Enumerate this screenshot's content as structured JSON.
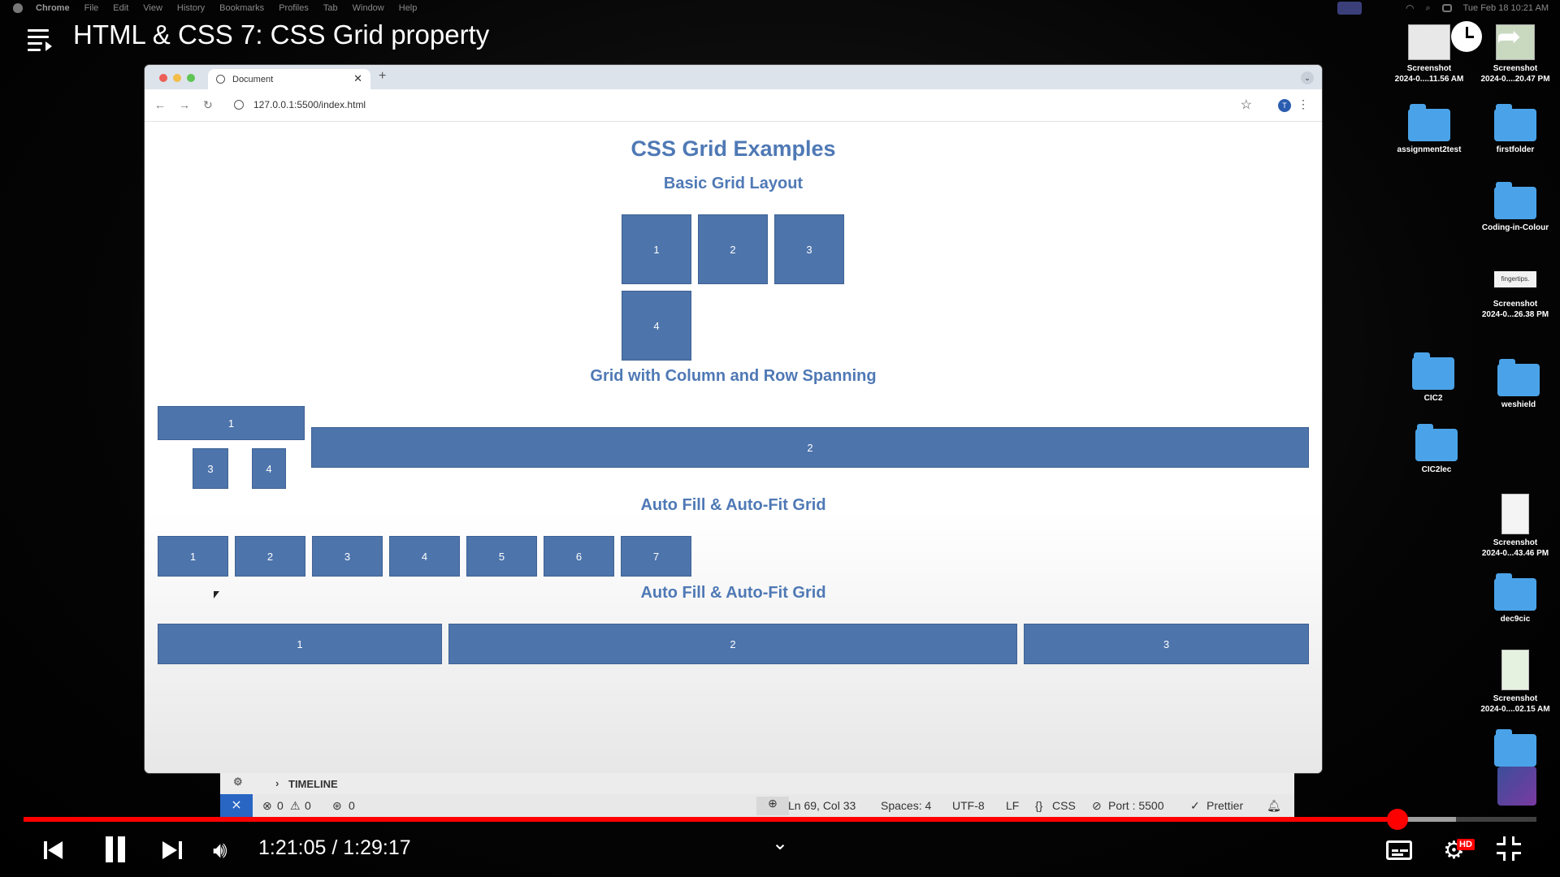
{
  "menubar": {
    "app": "Chrome",
    "items": [
      "File",
      "Edit",
      "View",
      "History",
      "Bookmarks",
      "Profiles",
      "Tab",
      "Window",
      "Help"
    ],
    "datetime": "Tue Feb 18  10:21 AM"
  },
  "video": {
    "title": "HTML & CSS 7: CSS Grid property",
    "time_current": "1:21:05",
    "time_separator": " / ",
    "time_total": "1:29:17",
    "progress_fraction": 0.908,
    "hd_badge": "HD"
  },
  "desktop": {
    "items": [
      {
        "type": "shot",
        "line1": "Screenshot",
        "line2": "2024-0....11.56 AM"
      },
      {
        "type": "shot",
        "line1": "Screenshot",
        "line2": "2024-0....20.47 PM"
      },
      {
        "type": "folder",
        "line1": "assignment2test",
        "line2": ""
      },
      {
        "type": "folder",
        "line1": "firstfolder",
        "line2": ""
      },
      {
        "type": "folder",
        "line1": "Coding-in-Colour",
        "line2": ""
      },
      {
        "type": "shot",
        "line1": "Screenshot",
        "line2": "2024-0...26.38 PM",
        "thumb_text": "fingertips."
      },
      {
        "type": "folder",
        "line1": "CIC2",
        "line2": ""
      },
      {
        "type": "folder",
        "line1": "weshield",
        "line2": ""
      },
      {
        "type": "folder",
        "line1": "CIC2lec",
        "line2": ""
      },
      {
        "type": "doc",
        "line1": "Screenshot",
        "line2": "2024-0...43.46 PM"
      },
      {
        "type": "folder",
        "line1": "dec9cic",
        "line2": ""
      },
      {
        "type": "doc",
        "line1": "Screenshot",
        "line2": "2024-0....02.15 AM"
      }
    ]
  },
  "browser": {
    "tab_title": "Document",
    "url": "127.0.0.1:5500/index.html",
    "avatar_letter": "T"
  },
  "page": {
    "title": "CSS Grid Examples",
    "section1": {
      "heading": "Basic Grid Layout",
      "items": [
        "1",
        "2",
        "3",
        "4"
      ]
    },
    "section2": {
      "heading": "Grid with Column and Row Spanning",
      "items": [
        "1",
        "2",
        "3",
        "4"
      ]
    },
    "section3": {
      "heading": "Auto Fill & Auto-Fit Grid",
      "items": [
        "1",
        "2",
        "3",
        "4",
        "5",
        "6",
        "7"
      ]
    },
    "section4": {
      "heading": "Auto Fill & Auto-Fit Grid",
      "items": [
        "1",
        "2",
        "3"
      ]
    }
  },
  "vscode": {
    "timeline_label": "TIMELINE",
    "errors": "0",
    "warnings": "0",
    "ports": "0",
    "cursor": "Ln 69, Col 33",
    "spaces": "Spaces: 4",
    "encoding": "UTF-8",
    "eol": "LF",
    "language": "CSS",
    "port": "Port : 5500",
    "formatter": "Prettier"
  },
  "colors": {
    "grid_box": "#4d74ab",
    "heading": "#4f79b5",
    "progress": "#ff0000",
    "vscode_remote": "#2966c4"
  }
}
